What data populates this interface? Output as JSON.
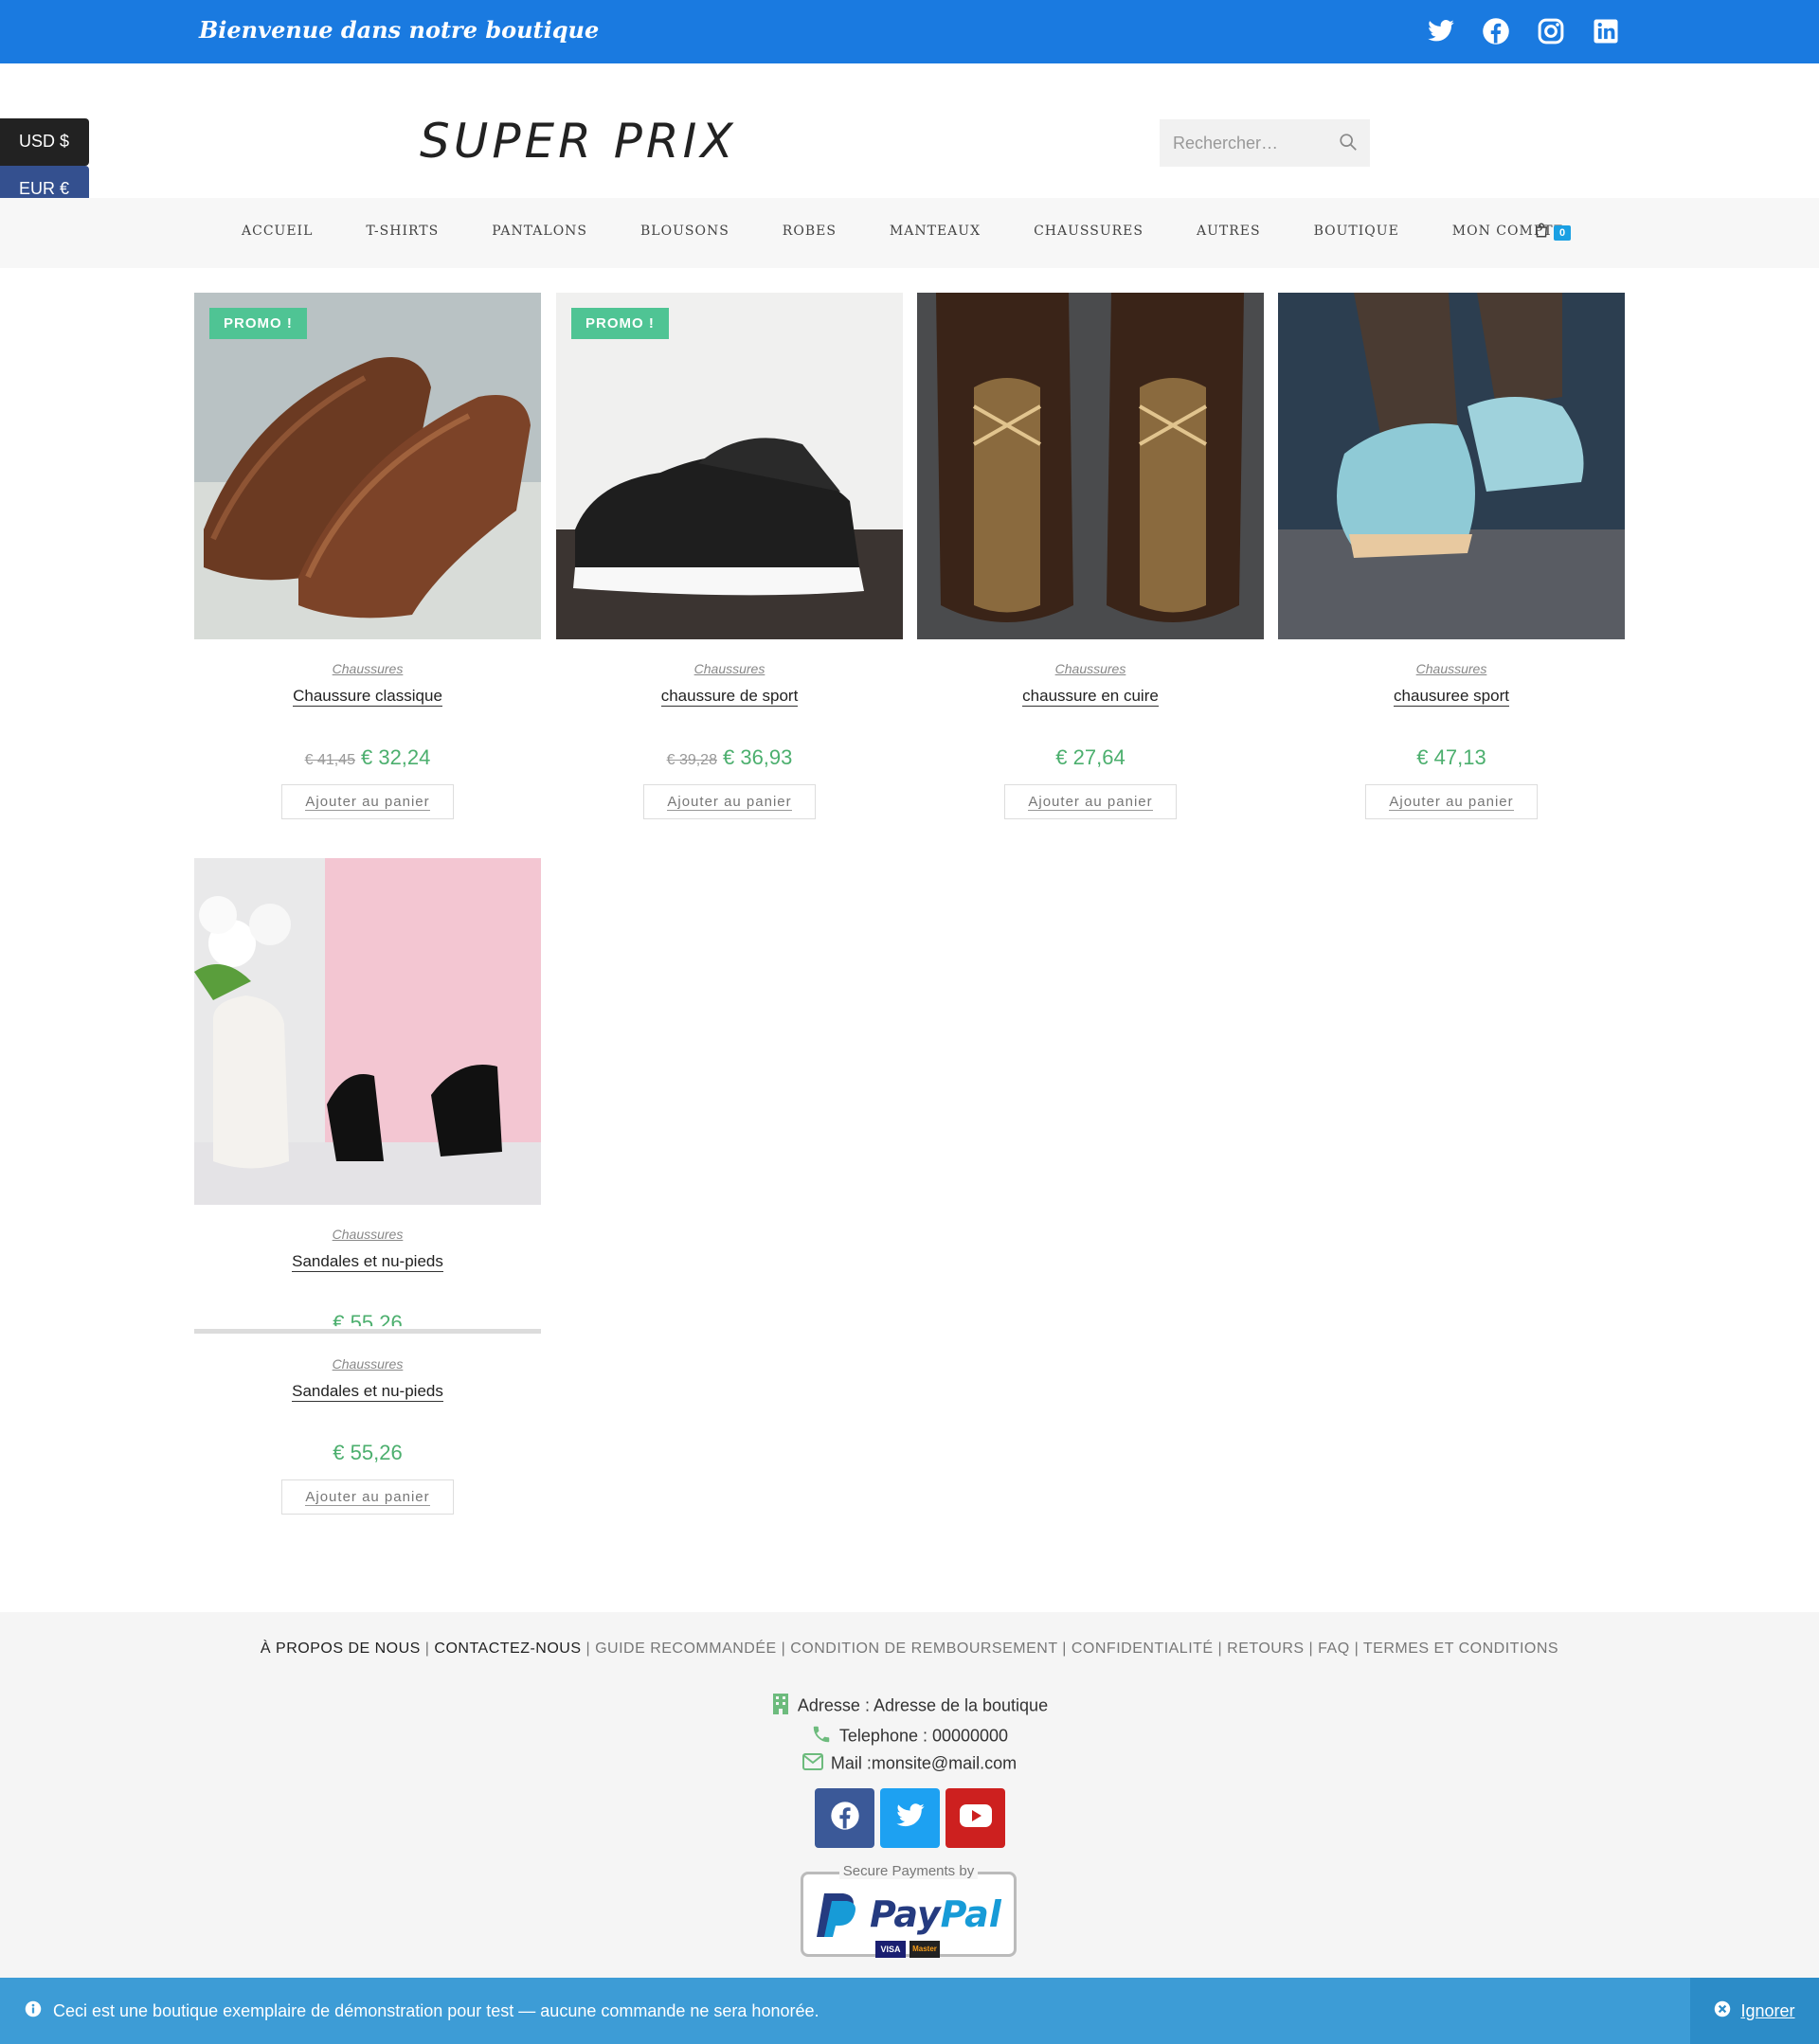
{
  "topbar": {
    "welcome": "Bienvenue dans notre boutique",
    "social_icons": [
      "twitter-icon",
      "facebook-icon",
      "instagram-icon",
      "linkedin-icon"
    ]
  },
  "currency": {
    "usd": "USD $",
    "eur": "EUR €"
  },
  "header": {
    "logo": "SUPER PRIX",
    "search_placeholder": "Rechercher…"
  },
  "nav": {
    "items": [
      "Accueil",
      "T-shirts",
      "Pantalons",
      "Blousons",
      "Robes",
      "Manteaux",
      "Chaussures",
      "Autres",
      "Boutique",
      "Mon compte"
    ],
    "cart_count": "0"
  },
  "products": [
    {
      "promo": "PROMO !",
      "category": "Chaussures",
      "name": "Chaussure classique",
      "old_price": "€ 41,45",
      "price": "€ 32,24",
      "button": "Ajouter au panier"
    },
    {
      "promo": "PROMO !",
      "category": "Chaussures",
      "name": "chaussure de sport",
      "old_price": "€ 39,28",
      "price": "€ 36,93",
      "button": "Ajouter au panier"
    },
    {
      "category": "Chaussures",
      "name": "chaussure en cuire",
      "price": "€ 27,64",
      "button": "Ajouter au panier"
    },
    {
      "category": "Chaussures",
      "name": "chausuree sport",
      "price": "€ 47,13",
      "button": "Ajouter au panier"
    },
    {
      "category": "Chaussures",
      "name": "Sandales et nu-pieds",
      "price": "€ 55,26",
      "button": "Ajouter au panier"
    }
  ],
  "hover_overlay": {
    "category": "Chaussures",
    "name": "Sandales et nu-pieds",
    "price": "€ 55,26"
  },
  "footer": {
    "links": [
      "À PROPOS DE NOUS",
      "CONTACTEZ-NOUS",
      "GUIDE RECOMMANDÉE",
      "CONDITION DE REMBOURSEMENT",
      "CONFIDENTIALITÉ",
      "RETOURS",
      "FAQ",
      "TERMES ET CONDITIONS"
    ],
    "address": "Adresse : Adresse de la boutique",
    "phone": "Telephone : 00000000",
    "mail": "Mail :monsite@mail.com",
    "payments_caption": "Secure Payments by",
    "paypal_pay": "Pay",
    "paypal_pal": "Pal",
    "card_labels": [
      "VISA",
      "Master"
    ]
  },
  "notice": {
    "message": "Ceci est une boutique exemplaire de démonstration pour test — aucune commande ne sera honorée.",
    "dismiss": "Ignorer"
  },
  "colors": {
    "topbar": "#1a7ae0",
    "promo": "#4fc494",
    "price": "#4caf6e",
    "notice": "#3d9cd6",
    "cart_badge": "#1ba0e3"
  }
}
